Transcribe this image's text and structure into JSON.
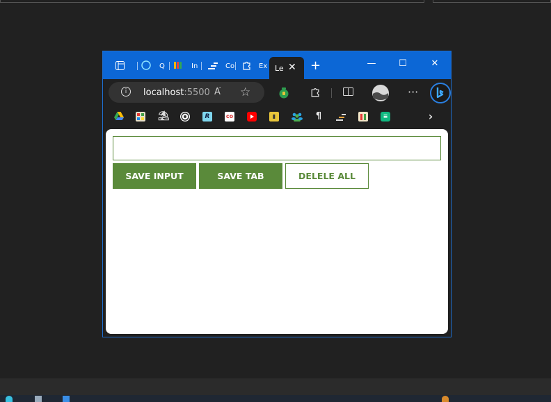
{
  "browser": {
    "tabs": [
      {
        "label": "Q",
        "icon": "chat-bubble-icon"
      },
      {
        "label": "In",
        "icon": "colorful-logo-icon"
      },
      {
        "label": "Co",
        "icon": "code-icon"
      },
      {
        "label": "Ex",
        "icon": "puzzle-icon"
      }
    ],
    "active_tab": {
      "label": "Le",
      "close": "✕"
    },
    "new_tab": "+",
    "window_buttons": {
      "minimize": "—",
      "maximize": "☐",
      "close": "✕"
    },
    "address": {
      "host": "localhost",
      "port": ":5500"
    },
    "read_aloud": "A͘",
    "favorite": "☆",
    "more": "···"
  },
  "page": {
    "input_value": "",
    "buttons": {
      "save_input": "SAVE INPUT",
      "save_tab": "SAVE TAB",
      "delete_all": "DELELE ALL"
    }
  },
  "colors": {
    "accent_green": "#5a8a3a",
    "titlebar_blue": "#0c67d6"
  }
}
